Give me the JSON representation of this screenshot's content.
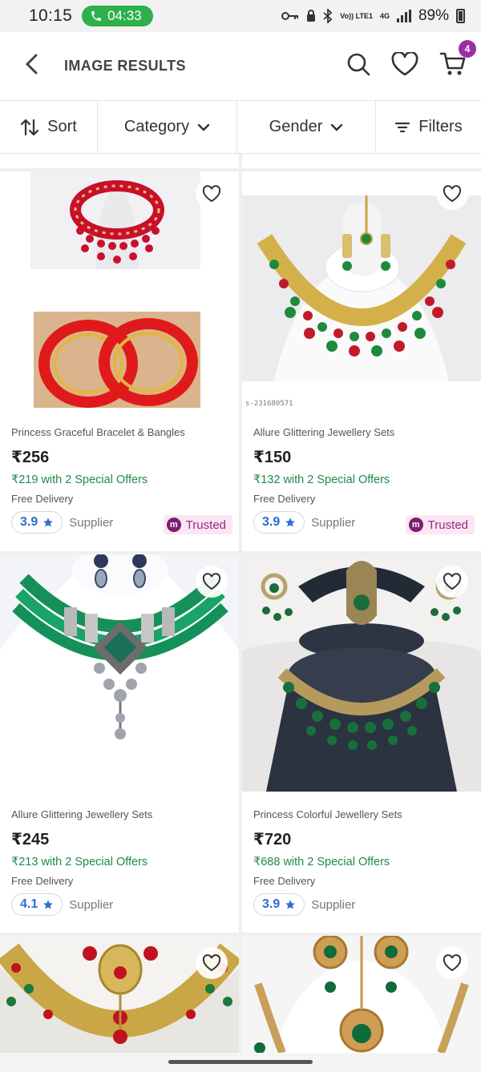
{
  "status": {
    "time": "10:15",
    "call_time": "04:33",
    "battery": "89%",
    "volte": "Vo)) LTE1",
    "net": "4G"
  },
  "header": {
    "title": "IMAGE RESULTS",
    "cart_count": "4"
  },
  "filters": {
    "sort": "Sort",
    "category": "Category",
    "gender": "Gender",
    "filters": "Filters"
  },
  "products": [
    {
      "name": "Princess Graceful Bracelet & Bangles",
      "price": "₹256",
      "offer": "₹219 with 2 Special Offers",
      "delivery": "Free Delivery",
      "rating": "3.9",
      "supplier": "Supplier",
      "trusted": "Trusted"
    },
    {
      "name": "Allure Glittering Jewellery Sets",
      "price": "₹150",
      "offer": "₹132 with 2 Special Offers",
      "delivery": "Free Delivery",
      "rating": "3.9",
      "supplier": "Supplier",
      "trusted": "Trusted",
      "code": "s-231680571"
    },
    {
      "name": "Allure Glittering Jewellery Sets",
      "price": "₹245",
      "offer": "₹213 with 2 Special Offers",
      "delivery": "Free Delivery",
      "rating": "4.1",
      "supplier": "Supplier"
    },
    {
      "name": "Princess Colorful Jewellery Sets",
      "price": "₹720",
      "offer": "₹688 with 2 Special Offers",
      "delivery": "Free Delivery",
      "rating": "3.9",
      "supplier": "Supplier"
    }
  ],
  "colors": {
    "accent": "#9c2fa6",
    "offer_green": "#1f8a4c",
    "rating_blue": "#2a6fd1",
    "trusted_bg": "#fce6f2"
  }
}
